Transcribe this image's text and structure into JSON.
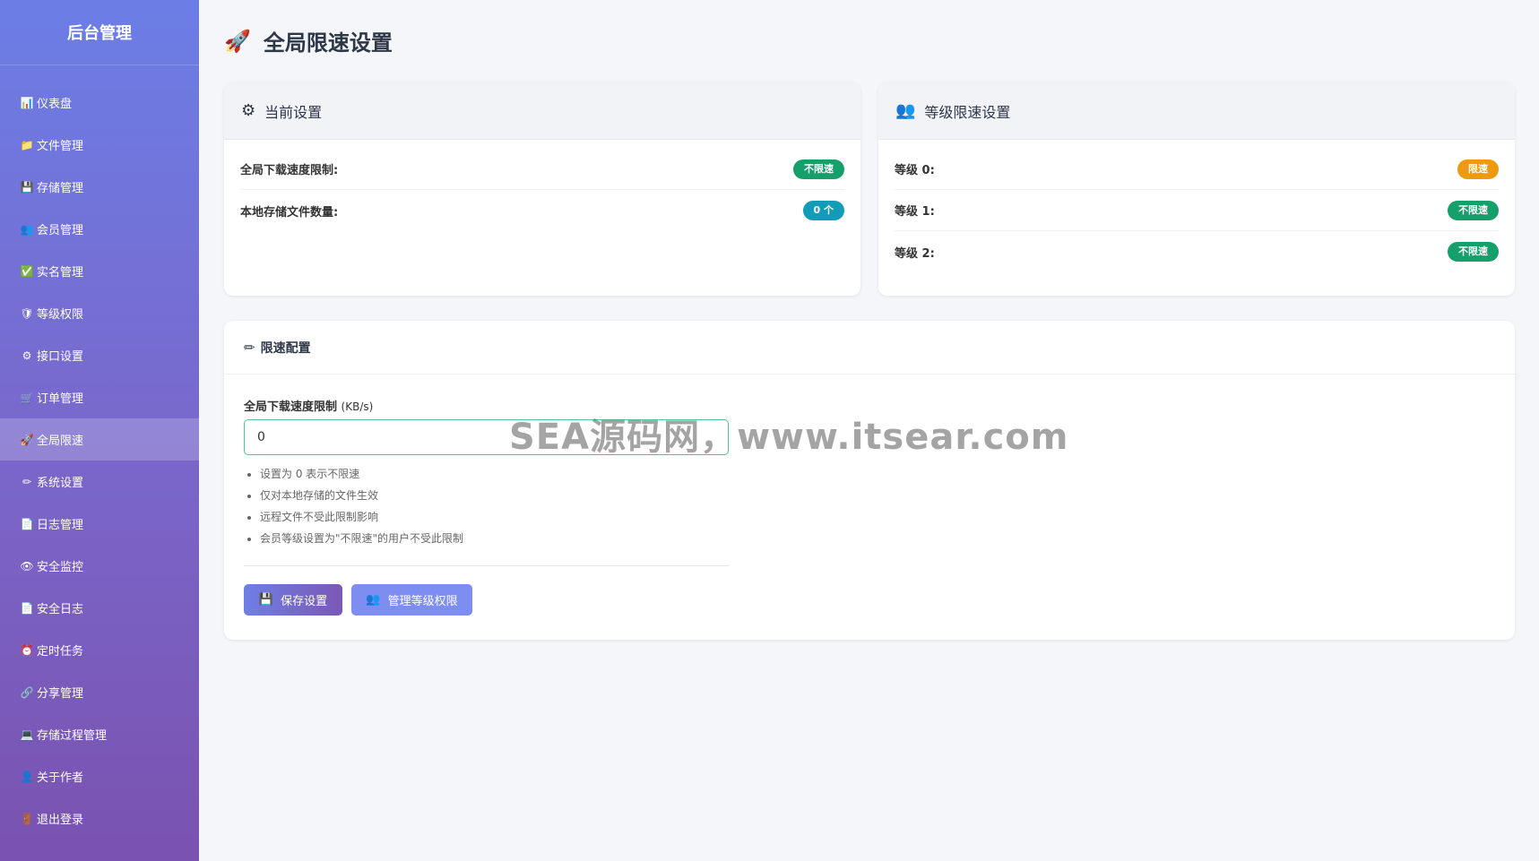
{
  "sidebar": {
    "brand": "后台管理",
    "items": [
      {
        "icon": "📊",
        "label": "仪表盘"
      },
      {
        "icon": "📁",
        "label": "文件管理"
      },
      {
        "icon": "💾",
        "label": "存储管理"
      },
      {
        "icon": "👥",
        "label": "会员管理"
      },
      {
        "icon": "✅",
        "label": "实名管理"
      },
      {
        "icon": "🛡",
        "label": "等级权限"
      },
      {
        "icon": "⚙",
        "label": "接口设置"
      },
      {
        "icon": "🛒",
        "label": "订单管理"
      },
      {
        "icon": "🚀",
        "label": "全局限速"
      },
      {
        "icon": "✏",
        "label": "系统设置"
      },
      {
        "icon": "📄",
        "label": "日志管理"
      },
      {
        "icon": "👁",
        "label": "安全监控"
      },
      {
        "icon": "📄",
        "label": "安全日志"
      },
      {
        "icon": "⏰",
        "label": "定时任务"
      },
      {
        "icon": "🔗",
        "label": "分享管理"
      },
      {
        "icon": "💻",
        "label": "存储过程管理"
      },
      {
        "icon": "👤",
        "label": "关于作者"
      },
      {
        "icon": "🚪",
        "label": "退出登录"
      }
    ],
    "active_index": 8
  },
  "page": {
    "title_icon": "🚀",
    "title": "全局限速设置"
  },
  "current_settings": {
    "header_icon": "⚙",
    "header": "当前设置",
    "rows": [
      {
        "label": "全局下载速度限制:",
        "badge": "不限速",
        "color": "#159f6b"
      },
      {
        "label": "本地存储文件数量:",
        "badge": "0 个",
        "color": "#129cb8"
      }
    ]
  },
  "level_settings": {
    "header_icon": "👥",
    "header": "等级限速设置",
    "rows": [
      {
        "label": "等级 0:",
        "badge": "限速",
        "color": "#ee9a0f"
      },
      {
        "label": "等级 1:",
        "badge": "不限速",
        "color": "#159f6b"
      },
      {
        "label": "等级 2:",
        "badge": "不限速",
        "color": "#159f6b"
      }
    ]
  },
  "config": {
    "header_icon": "✏",
    "header": "限速配置",
    "field_label": "全局下载速度限制",
    "field_unit": "(KB/s)",
    "field_value": "0",
    "hints": [
      "设置为 0 表示不限速",
      "仅对本地存储的文件生效",
      "远程文件不受此限制影响",
      "会员等级设置为\"不限速\"的用户不受此限制"
    ],
    "save_icon": "💾",
    "save_label": "保存设置",
    "level_icon": "👥",
    "level_label": "管理等级权限"
  },
  "watermark": "SEA源码网，www.itsear.com"
}
